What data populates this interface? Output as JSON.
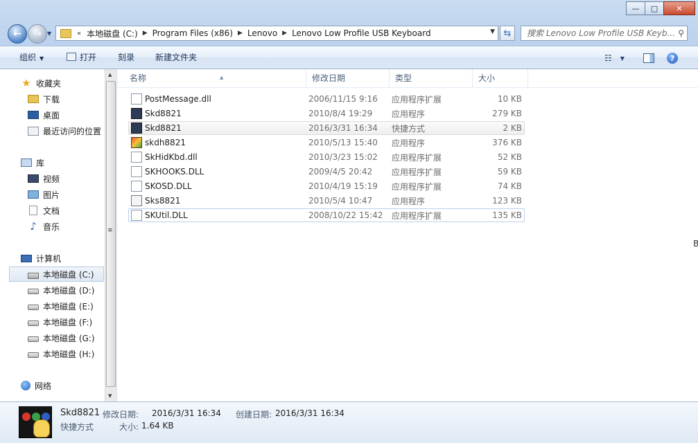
{
  "window": {
    "controls": {
      "minimize": "—",
      "maximize": "□",
      "close": "✕"
    }
  },
  "address": {
    "lead": "«",
    "crumbs": [
      "本地磁盘 (C:)",
      "Program Files (x86)",
      "Lenovo",
      "Lenovo Low Profile USB Keyboard"
    ],
    "search_placeholder": "搜索 Lenovo Low Profile USB Keyb..."
  },
  "toolbar": {
    "organize": "组织",
    "open": "打开",
    "burn": "刻录",
    "new_folder": "新建文件夹"
  },
  "nav": {
    "favorites": {
      "label": "收藏夹",
      "items": [
        "下载",
        "桌面",
        "最近访问的位置"
      ]
    },
    "libraries": {
      "label": "库",
      "items": [
        "视频",
        "图片",
        "文档",
        "音乐"
      ]
    },
    "computer": {
      "label": "计算机",
      "items": [
        "本地磁盘 (C:)",
        "本地磁盘 (D:)",
        "本地磁盘 (E:)",
        "本地磁盘 (F:)",
        "本地磁盘 (G:)",
        "本地磁盘 (H:)"
      ]
    },
    "network": {
      "label": "网络"
    },
    "selected": "本地磁盘 (C:)"
  },
  "columns": {
    "name": "名称",
    "date": "修改日期",
    "type": "类型",
    "size": "大小"
  },
  "files": [
    {
      "name": "PostMessage.dll",
      "date": "2006/11/15 9:16",
      "type": "应用程序扩展",
      "size": "10 KB",
      "icon": "dll-icon"
    },
    {
      "name": "Skd8821",
      "date": "2010/8/4 19:29",
      "type": "应用程序",
      "size": "279 KB",
      "icon": "app-icon"
    },
    {
      "name": "Skd8821",
      "date": "2016/3/31 16:34",
      "type": "快捷方式",
      "size": "2 KB",
      "icon": "shortcut-icon"
    },
    {
      "name": "skdh8821",
      "date": "2010/5/13 15:40",
      "type": "应用程序",
      "size": "376 KB",
      "icon": "setup-icon"
    },
    {
      "name": "SkHidKbd.dll",
      "date": "2010/3/23 15:02",
      "type": "应用程序扩展",
      "size": "52 KB",
      "icon": "dll-icon"
    },
    {
      "name": "SKHOOKS.DLL",
      "date": "2009/4/5 20:42",
      "type": "应用程序扩展",
      "size": "59 KB",
      "icon": "dll-icon"
    },
    {
      "name": "SKOSD.DLL",
      "date": "2010/4/19 15:19",
      "type": "应用程序扩展",
      "size": "74 KB",
      "icon": "dll-icon"
    },
    {
      "name": "Sks8821",
      "date": "2010/5/4 10:47",
      "type": "应用程序",
      "size": "123 KB",
      "icon": "generic-app-icon"
    },
    {
      "name": "SKUtil.DLL",
      "date": "2008/10/22 15:42",
      "type": "应用程序扩展",
      "size": "135 KB",
      "icon": "dll-icon"
    }
  ],
  "details": {
    "name": "Skd8821",
    "type": "快捷方式",
    "modified_label": "修改日期:",
    "modified": "2016/3/31 16:34",
    "created_label": "创建日期:",
    "created": "2016/3/31 16:34",
    "size_label": "大小:",
    "size": "1.64 KB"
  },
  "peek_text": "B"
}
